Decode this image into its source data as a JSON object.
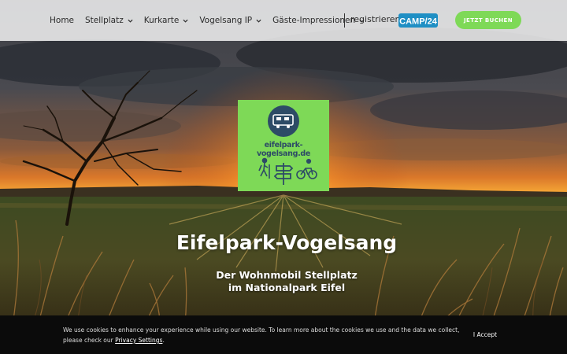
{
  "nav": {
    "items": [
      {
        "label": "Home",
        "has_dropdown": false
      },
      {
        "label": "Stellplatz",
        "has_dropdown": true
      },
      {
        "label": "Kurkarte",
        "has_dropdown": true
      },
      {
        "label": "Vogelsang IP",
        "has_dropdown": true
      },
      {
        "label": "Gäste-Impressionen",
        "has_dropdown": true
      }
    ],
    "register_label": "registrieren",
    "camp24_logo": "CAMP/24",
    "book_button": "JETZT BUCHEN"
  },
  "logo": {
    "text": "eifelpark-vogelsang.de",
    "icons": [
      "camper-van-icon",
      "hiker-icon",
      "signpost-icon",
      "cyclist-icon"
    ]
  },
  "hero": {
    "title": "Eifelpark-Vogelsang",
    "subtitle_line1": "Der Wohnmobil Stellplatz",
    "subtitle_line2": "im Nationalpark Eifel"
  },
  "cookie": {
    "text": "We use cookies to enhance your experience while using our website. To learn more about the cookies we use and the data we collect, please check our",
    "link": "Privacy Settings",
    "suffix": ".",
    "accept_label": "I Accept"
  },
  "colors": {
    "accent_green": "#7ed957",
    "logo_blue": "#2d4b66",
    "camp24_blue": "#1f8fc4"
  }
}
